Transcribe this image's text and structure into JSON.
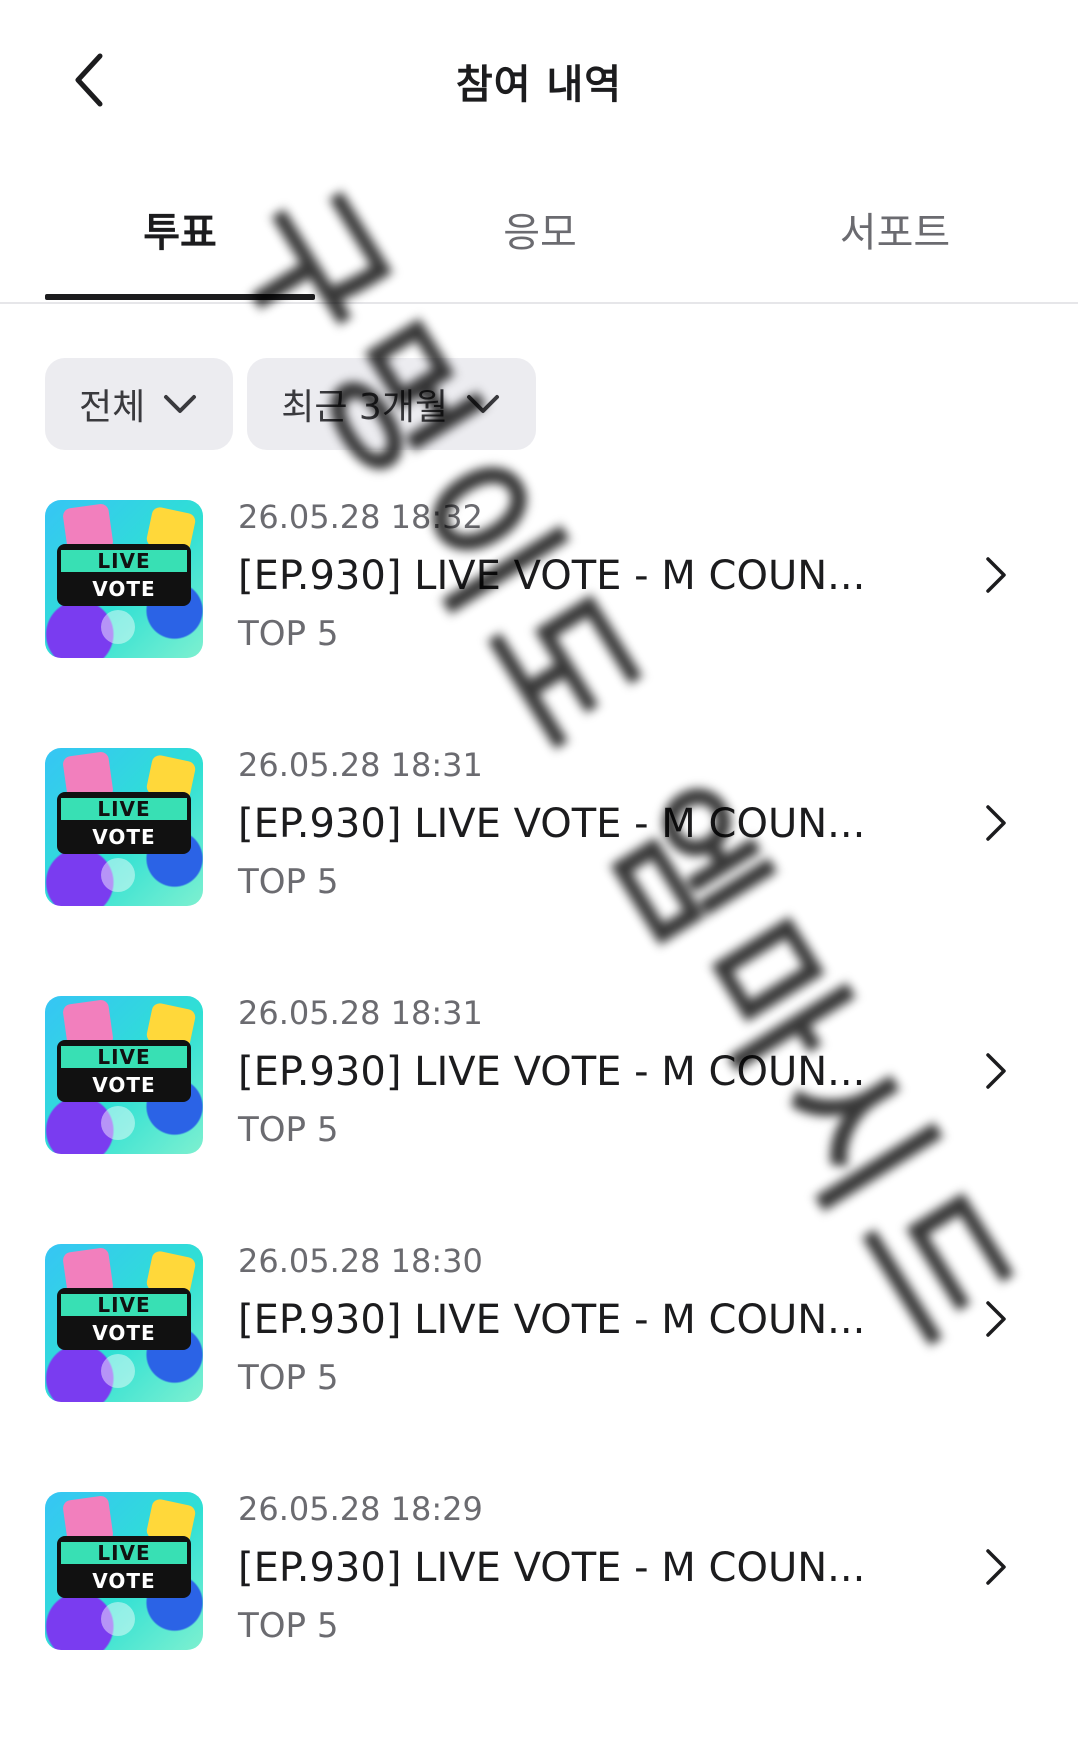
{
  "header": {
    "title": "참여 내역",
    "back_icon": "chevron-left-icon"
  },
  "tabs": [
    {
      "label": "투표",
      "active": true
    },
    {
      "label": "응모",
      "active": false
    },
    {
      "label": "서포트",
      "active": false
    }
  ],
  "filters": [
    {
      "label": "전체",
      "icon": "chevron-down-icon"
    },
    {
      "label": "최근 3개월",
      "icon": "chevron-down-icon"
    }
  ],
  "items": [
    {
      "date": "26.05.28 18:32",
      "title": "[EP.930] LIVE VOTE - M COUN...",
      "rank": "TOP 5",
      "thumb_line1": "LIVE",
      "thumb_line2": "VOTE"
    },
    {
      "date": "26.05.28 18:31",
      "title": "[EP.930] LIVE VOTE - M COUN...",
      "rank": "TOP 5",
      "thumb_line1": "LIVE",
      "thumb_line2": "VOTE"
    },
    {
      "date": "26.05.28 18:31",
      "title": "[EP.930] LIVE VOTE - M COUN...",
      "rank": "TOP 5",
      "thumb_line1": "LIVE",
      "thumb_line2": "VOTE"
    },
    {
      "date": "26.05.28 18:30",
      "title": "[EP.930] LIVE VOTE - M COUN...",
      "rank": "TOP 5",
      "thumb_line1": "LIVE",
      "thumb_line2": "VOTE"
    },
    {
      "date": "26.05.28 18:29",
      "title": "[EP.930] LIVE VOTE - M COUN...",
      "rank": "TOP 5",
      "thumb_line1": "LIVE",
      "thumb_line2": "VOTE"
    }
  ],
  "watermark": "구멍이도 엠마시드"
}
